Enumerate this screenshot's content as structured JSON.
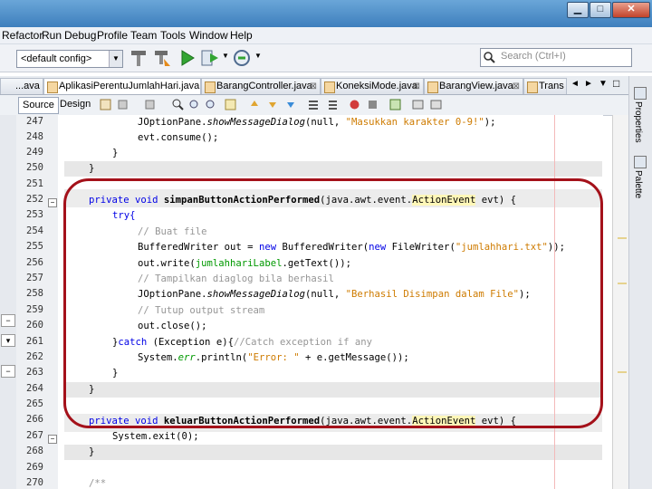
{
  "window": {
    "minimize": "▁",
    "maximize": "□",
    "close": "✕"
  },
  "menu": [
    "Refactor",
    "Run",
    "Debug",
    "Profile",
    "Team",
    "Tools",
    "Window",
    "Help"
  ],
  "toolbar": {
    "config_value": "<default config>",
    "icons": [
      "hammer-icon",
      "clean-build-icon",
      "run-icon",
      "debug-icon",
      "profile-icon"
    ],
    "search_placeholder": "Search (Ctrl+I)"
  },
  "tabs": [
    {
      "label": "...ava",
      "active": false
    },
    {
      "label": "AplikasiPerentuJumlahHari.java",
      "active": true
    },
    {
      "label": "BarangController.java",
      "active": false
    },
    {
      "label": "KoneksiMode.java",
      "active": false
    },
    {
      "label": "BarangView.java",
      "active": false
    },
    {
      "label": "Trans",
      "active": false
    }
  ],
  "editor_tabs": {
    "source": "Source",
    "design": "Design"
  },
  "side_panels": [
    "Properties",
    "Palette"
  ],
  "line_numbers": [
    "247",
    "248",
    "249",
    "250",
    "251",
    "252",
    "253",
    "254",
    "255",
    "256",
    "257",
    "258",
    "259",
    "260",
    "261",
    "262",
    "263",
    "264",
    "265",
    "266",
    "267",
    "268",
    "269",
    "270"
  ],
  "code": {
    "l247_call": "JOptionPane.",
    "l247_method": "showMessageDialog",
    "l247_args_a": "(null, ",
    "l247_str": "\"Masukkan karakter 0-9!\"",
    "l247_end": ");",
    "l248": "evt.consume();",
    "l249": "}",
    "l250": "}",
    "l252_kw": "private void ",
    "l252_name": "simpanButtonActionPerformed",
    "l252_params": "(java.awt.event.",
    "l252_type": "ActionEvent",
    "l252_arg": " evt) {",
    "l253": "try{",
    "l254": "// Buat file",
    "l255_type": "BufferedWriter out = ",
    "l255_new": "new",
    "l255_mid": " BufferedWriter(",
    "l255_new2": "new",
    "l255_mid2": " FileWriter(",
    "l255_str": "\"jumlahhari.txt\"",
    "l255_end": "));",
    "l256_a": "out.write(",
    "l256_b": "jumlahhariLabel",
    "l256_c": ".getText());",
    "l257": "// Tampilkan diaglog bila berhasil",
    "l258_call": "JOptionPane.",
    "l258_method": "showMessageDialog",
    "l258_args_a": "(null, ",
    "l258_str": "\"Berhasil Disimpan dalam File\"",
    "l258_end": ");",
    "l259": "// Tutup output stream",
    "l260": "out.close();",
    "l261_a": "}",
    "l261_kw": "catch",
    "l261_b": " (Exception e){",
    "l261_cm": "//Catch exception if any",
    "l262_a": "System.",
    "l262_err": "err",
    "l262_b": ".println(",
    "l262_str": "\"Error: \"",
    "l262_c": " + e.getMessage());",
    "l263": "}",
    "l264": "}",
    "l266_kw": "private void ",
    "l266_name": "keluarButtonActionPerformed",
    "l266_params": "(java.awt.event.",
    "l266_type": "ActionEvent",
    "l266_arg": " evt) {",
    "l267": "System.exit(0);",
    "l268": "}",
    "l270": "/**"
  },
  "colors": {
    "keyword": "#0000e6",
    "string": "#ce7b00",
    "comment": "#969696",
    "highlight_box": "#a4111a"
  }
}
